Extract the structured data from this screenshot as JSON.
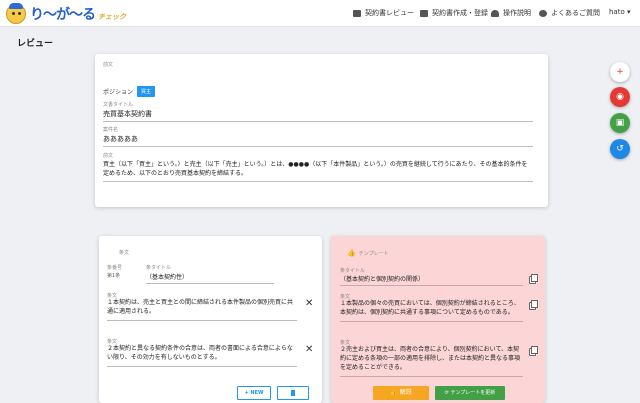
{
  "app": {
    "logo_text": "り〜が〜る",
    "logo_sub": "チェック"
  },
  "nav": {
    "items": [
      {
        "label": "契約書レビュー",
        "icon": "edit-icon"
      },
      {
        "label": "契約書作成・登録",
        "icon": "document-icon"
      },
      {
        "label": "操作説明",
        "icon": "graduation-cap-icon"
      },
      {
        "label": "よくあるご質問",
        "icon": "info-icon"
      }
    ],
    "user": "hato ▾"
  },
  "page": {
    "title": "レビュー"
  },
  "top_card": {
    "section": "前文",
    "position_label": "ポジション",
    "position_value": "買主",
    "doc_title_label": "文書タイトル",
    "doc_title": "売買基本契約書",
    "case_label": "案件名",
    "case_name": "あああああ",
    "preamble_label": "前文",
    "preamble": "買主（以下「買主」という。）と売主（以下「売主」という。）とは、●●●●（以下「本件製品」という。）の売買を継続して行うにあたり、その基本的条件を定めるため、以下のとおり売買基本契約を締結する。"
  },
  "fabs": [
    {
      "icon": "plus-icon",
      "label": "+",
      "color": "#ffffff",
      "text_color": "#e53935"
    },
    {
      "icon": "eye-icon",
      "label": "◉",
      "color": "#e53935",
      "text_color": "#ffffff"
    },
    {
      "icon": "save-icon",
      "label": "▣",
      "color": "#43a047",
      "text_color": "#ffffff"
    },
    {
      "icon": "history-icon",
      "label": "↺",
      "color": "#1e88e5",
      "text_color": "#ffffff"
    }
  ],
  "clause_card": {
    "section": "条文",
    "article_no_label": "条番号",
    "article_no": "第1条",
    "article_title_label": "条タイトル",
    "article_title": "（基本契約性）",
    "clauses": [
      {
        "label": "条文",
        "text": "１本契約は、売主と買主との間に締結される本件製品の個別売買に共通に適用される。"
      },
      {
        "label": "条文",
        "text": "２本契約と異なる契約条件の合意は、両者の書面による合意によらない限り、その効力を有しないものとする。"
      }
    ],
    "new_button": "+ NEW",
    "delete_icon": "trash-icon"
  },
  "template_card": {
    "header": "テンプレート",
    "header_icon": "thumbs-up-icon",
    "title_label": "条タイトル",
    "title": "（基本契約と個別契約の関係）",
    "clauses": [
      {
        "label": "条文",
        "text": "１本製品の個々の売買においては、個別契約が締結されるところ、本契約は、個別契約に共通する事項について定めるものである。"
      },
      {
        "label": "条文",
        "text": "２売主および買主は、両者の合意により、個別契約において、本契約に定める条項の一部の適用を排除し、または本契約と異なる事項を定めることができる。"
      }
    ],
    "explain_button": "解説",
    "update_button": "テンプレートを更新"
  }
}
